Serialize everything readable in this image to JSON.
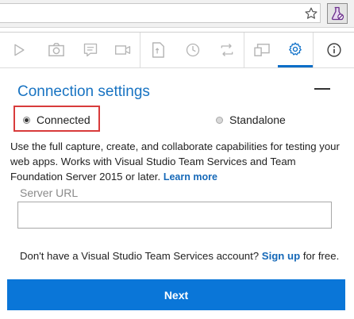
{
  "browser": {
    "star_icon": "star-outline-icon",
    "extension_icon": "flask-extension-icon"
  },
  "toolbar": {
    "items": [
      {
        "name": "play-icon",
        "active": false
      },
      {
        "name": "camera-icon",
        "active": false
      },
      {
        "name": "note-icon",
        "active": false
      },
      {
        "name": "video-icon",
        "active": false
      },
      {
        "name": "document-icon",
        "active": false
      },
      {
        "name": "clock-icon",
        "active": false
      },
      {
        "name": "repeat-icon",
        "active": false
      },
      {
        "name": "screens-icon",
        "active": false
      },
      {
        "name": "gear-icon",
        "active": true
      },
      {
        "name": "info-icon",
        "active": false
      }
    ]
  },
  "connection": {
    "title": "Connection settings",
    "collapse_icon": "minus-icon",
    "option_connected": "Connected",
    "option_standalone": "Standalone",
    "selected": "Connected",
    "description": "Use the full capture, create, and collaborate capabilities for testing your web apps. Works with Visual Studio Team Services and Team Foundation Server 2015 or later.",
    "learn_more": "Learn more",
    "server_url_label": "Server URL",
    "server_url_value": "",
    "signup_prefix": "Don't have a Visual Studio Team Services account?",
    "signup_link": "Sign up",
    "signup_suffix": "for free.",
    "next_label": "Next"
  },
  "colors": {
    "accent": "#0a76d8",
    "title": "#1873c2",
    "highlight_border": "#d83b3b"
  }
}
